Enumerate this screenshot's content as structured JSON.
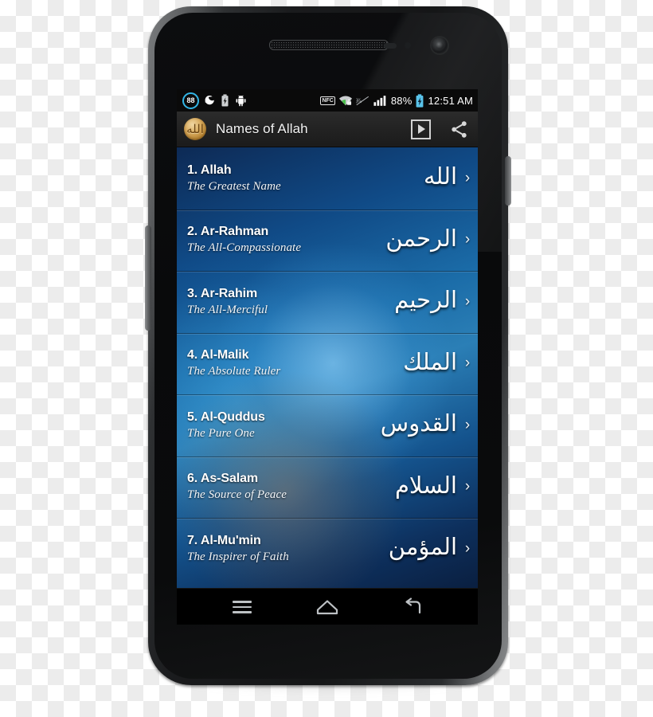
{
  "status_bar": {
    "left_icons": [
      {
        "name": "counter-badge-icon",
        "label": "88"
      },
      {
        "name": "sync-moon-icon",
        "label": ""
      },
      {
        "name": "battery-charging-small-icon",
        "label": ""
      },
      {
        "name": "android-bug-icon",
        "label": ""
      }
    ],
    "nfc_label": "NFC",
    "right_icons": [
      {
        "name": "nfc-icon",
        "label": "NFC"
      },
      {
        "name": "wifi-secured-icon",
        "label": ""
      },
      {
        "name": "silent-mode-icon",
        "label": ""
      },
      {
        "name": "signal-bars-icon",
        "label": ""
      }
    ],
    "battery_percent": "88%",
    "clock": "12:51 AM"
  },
  "action_bar": {
    "app_icon_glyph": "الله",
    "title": "Names of Allah",
    "play_button_label": "play",
    "share_button_label": "share"
  },
  "list": {
    "items": [
      {
        "index": "1.",
        "name": "1. Allah",
        "meaning": "The Greatest Name",
        "arabic": "الله",
        "chevron": "›"
      },
      {
        "index": "2.",
        "name": "2. Ar-Rahman",
        "meaning": "The All-Compassionate",
        "arabic": "الرحمن",
        "chevron": "›"
      },
      {
        "index": "3.",
        "name": "3. Ar-Rahim",
        "meaning": "The All-Merciful",
        "arabic": "الرحيم",
        "chevron": "›"
      },
      {
        "index": "4.",
        "name": "4. Al-Malik",
        "meaning": "The Absolute Ruler",
        "arabic": "الملك",
        "chevron": "›"
      },
      {
        "index": "5.",
        "name": "5. Al-Quddus",
        "meaning": "The Pure One",
        "arabic": "القدوس",
        "chevron": "›"
      },
      {
        "index": "6.",
        "name": "6. As-Salam",
        "meaning": "The Source of Peace",
        "arabic": "السلام",
        "chevron": "›"
      },
      {
        "index": "7.",
        "name": "7. Al-Mu'min",
        "meaning": "The Inspirer of Faith",
        "arabic": "المؤمن",
        "chevron": "›"
      }
    ]
  },
  "nav_bar": {
    "menu_label": "menu",
    "home_label": "home",
    "back_label": "back"
  },
  "colors": {
    "accent_blue": "#33b5e5",
    "screen_blue_mid": "#2b7fb6",
    "screen_blue_dark": "#0a1f40",
    "action_bar": "#232323",
    "app_icon_gold": "#d9ab5e"
  }
}
